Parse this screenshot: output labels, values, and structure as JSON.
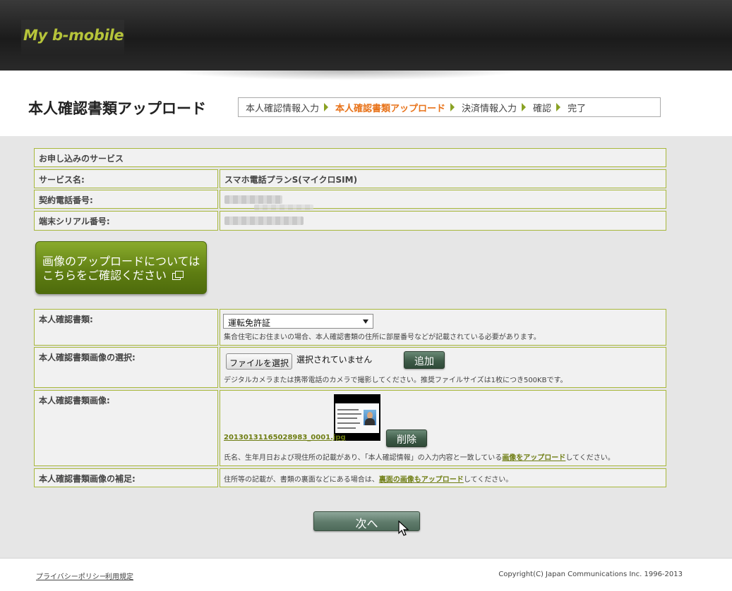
{
  "header": {
    "logo_text": "My b-mobile"
  },
  "page": {
    "title": "本人確認書類アップロード",
    "steps": [
      {
        "label": "本人確認情報入力",
        "active": false
      },
      {
        "label": "本人確認書類アップロード",
        "active": true
      },
      {
        "label": "決済情報入力",
        "active": false
      },
      {
        "label": "確認",
        "active": false
      },
      {
        "label": "完了",
        "active": false
      }
    ]
  },
  "service": {
    "heading": "お申し込みのサービス",
    "service_name_label": "サービス名:",
    "service_name_value": "スマホ電話プランS(マイクロSIM)",
    "phone_label": "契約電話番号:",
    "serial_label": "端末シリアル番号:"
  },
  "info_button": {
    "line1": "画像のアップロードについては",
    "line2": "こちらをご確認ください"
  },
  "form": {
    "doc_type_label": "本人確認書類:",
    "doc_type_selected": "運転免許証",
    "doc_type_note": "集合住宅にお住まいの場合、本人確認書類の住所に部屋番号などが記載されている必要があります。",
    "select_image_label": "本人確認書類画像の選択:",
    "file_button_label": "ファイルを選択",
    "file_status": "選択されていません",
    "add_button_label": "追加",
    "select_image_note": "デジタルカメラまたは携帯電話のカメラで撮影してください。推奨ファイルサイズは1枚につき500KBです。",
    "image_label": "本人確認書類画像:",
    "uploaded_filename": "20130131165028983_0001.jpg",
    "delete_button_label": "削除",
    "image_note_prefix": "氏名、生年月日および現住所の記載があり、「本人確認情報」の入力内容と一致している",
    "image_note_link": "画像をアップロード",
    "image_note_suffix": "してください。",
    "supplement_label": "本人確認書類画像の補足:",
    "supplement_note_prefix": "住所等の記載が、書類の裏面などにある場合は、",
    "supplement_note_link": "裏面の画像もアップロード",
    "supplement_note_suffix": "してください。"
  },
  "next_button_label": "次へ",
  "footer": {
    "privacy_link": "プライバシーポリシー",
    "terms_link": "利用規定",
    "copyright": "Copyright(C) Japan Communications Inc. 1996-2013"
  },
  "colors": {
    "accent_green": "#6e7d12",
    "active_step": "#e8731a",
    "border_green": "#a8b83c"
  }
}
